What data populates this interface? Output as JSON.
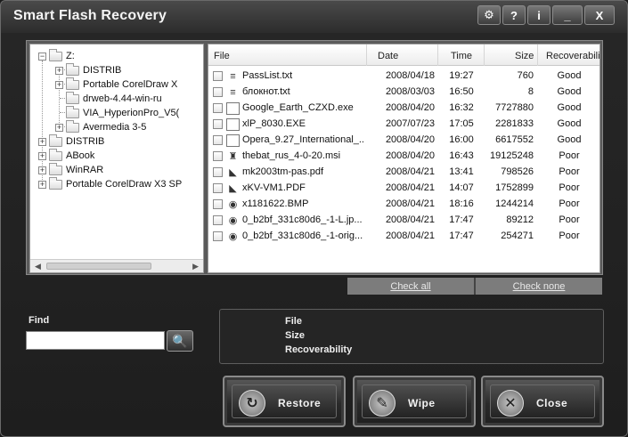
{
  "window": {
    "title": "Smart Flash Recovery"
  },
  "titlebar_buttons": [
    {
      "icon": "settings-icon",
      "glyph": "⚙"
    },
    {
      "icon": "help-icon",
      "glyph": "?"
    },
    {
      "icon": "info-icon",
      "glyph": "i"
    },
    {
      "icon": "minimize-icon",
      "glyph": "_"
    },
    {
      "icon": "close-icon",
      "glyph": "X"
    }
  ],
  "tree": {
    "nodes": [
      {
        "label": "Z:",
        "expander": "−"
      },
      {
        "label": "DISTRIB",
        "expander": "+"
      },
      {
        "label": "Portable CorelDraw X",
        "expander": "+"
      },
      {
        "label": "drweb-4.44-win-ru",
        "expander": ""
      },
      {
        "label": "VIA_HyperionPro_V5(",
        "expander": ""
      },
      {
        "label": "Avermedia 3-5",
        "expander": "+"
      },
      {
        "label": "DISTRIB",
        "expander": "+"
      },
      {
        "label": "ABook",
        "expander": "+"
      },
      {
        "label": "WinRAR",
        "expander": "+"
      },
      {
        "label": "Portable CorelDraw X3 SP",
        "expander": "+"
      }
    ]
  },
  "files": {
    "headers": {
      "file": "File",
      "date": "Date",
      "time": "Time",
      "size": "Size",
      "recoverability": "Recoverability"
    },
    "rows": [
      {
        "name": "PassList.txt",
        "date": "2008/04/18",
        "time": "19:27",
        "size": "760",
        "rec": "Good",
        "icon": "text-file-icon",
        "glyph": "≡"
      },
      {
        "name": "блокнот.txt",
        "date": "2008/03/03",
        "time": "16:50",
        "size": "8",
        "rec": "Good",
        "icon": "text-file-icon",
        "glyph": "≡"
      },
      {
        "name": "Google_Earth_CZXD.exe",
        "date": "2008/04/20",
        "time": "16:32",
        "size": "7727880",
        "rec": "Good",
        "icon": "exe-file-icon",
        "glyph": ""
      },
      {
        "name": "xlP_8030.EXE",
        "date": "2007/07/23",
        "time": "17:05",
        "size": "2281833",
        "rec": "Good",
        "icon": "exe-file-icon",
        "glyph": ""
      },
      {
        "name": "Opera_9.27_International_...",
        "date": "2008/04/20",
        "time": "16:00",
        "size": "6617552",
        "rec": "Good",
        "icon": "exe-file-icon",
        "glyph": ""
      },
      {
        "name": "thebat_rus_4-0-20.msi",
        "date": "2008/04/20",
        "time": "16:43",
        "size": "19125248",
        "rec": "Poor",
        "icon": "installer-file-icon",
        "glyph": "♜"
      },
      {
        "name": "mk2003tm-pas.pdf",
        "date": "2008/04/21",
        "time": "13:41",
        "size": "798526",
        "rec": "Poor",
        "icon": "pdf-file-icon",
        "glyph": "◣"
      },
      {
        "name": "xKV-VM1.PDF",
        "date": "2008/04/21",
        "time": "14:07",
        "size": "1752899",
        "rec": "Poor",
        "icon": "pdf-file-icon",
        "glyph": "◣"
      },
      {
        "name": "x1181622.BMP",
        "date": "2008/04/21",
        "time": "18:16",
        "size": "1244214",
        "rec": "Poor",
        "icon": "image-file-icon",
        "glyph": "◉"
      },
      {
        "name": "0_b2bf_331c80d6_-1-L.jp...",
        "date": "2008/04/21",
        "time": "17:47",
        "size": "89212",
        "rec": "Poor",
        "icon": "image-file-icon",
        "glyph": "◉"
      },
      {
        "name": "0_b2bf_331c80d6_-1-orig...",
        "date": "2008/04/21",
        "time": "17:47",
        "size": "254271",
        "rec": "Poor",
        "icon": "image-file-icon",
        "glyph": "◉"
      }
    ]
  },
  "check": {
    "all": "Check all",
    "none": "Check none"
  },
  "find": {
    "label": "Find",
    "value": "",
    "placeholder": ""
  },
  "info": {
    "file_label": "File",
    "size_label": "Size",
    "recoverability_label": "Recoverability"
  },
  "actions": {
    "restore": {
      "label": "Restore",
      "icon": "restore-icon",
      "glyph": "↻"
    },
    "wipe": {
      "label": "Wipe",
      "icon": "eraser-icon",
      "glyph": "✎"
    },
    "close": {
      "label": "Close",
      "icon": "close-circle-icon",
      "glyph": "✕"
    }
  }
}
